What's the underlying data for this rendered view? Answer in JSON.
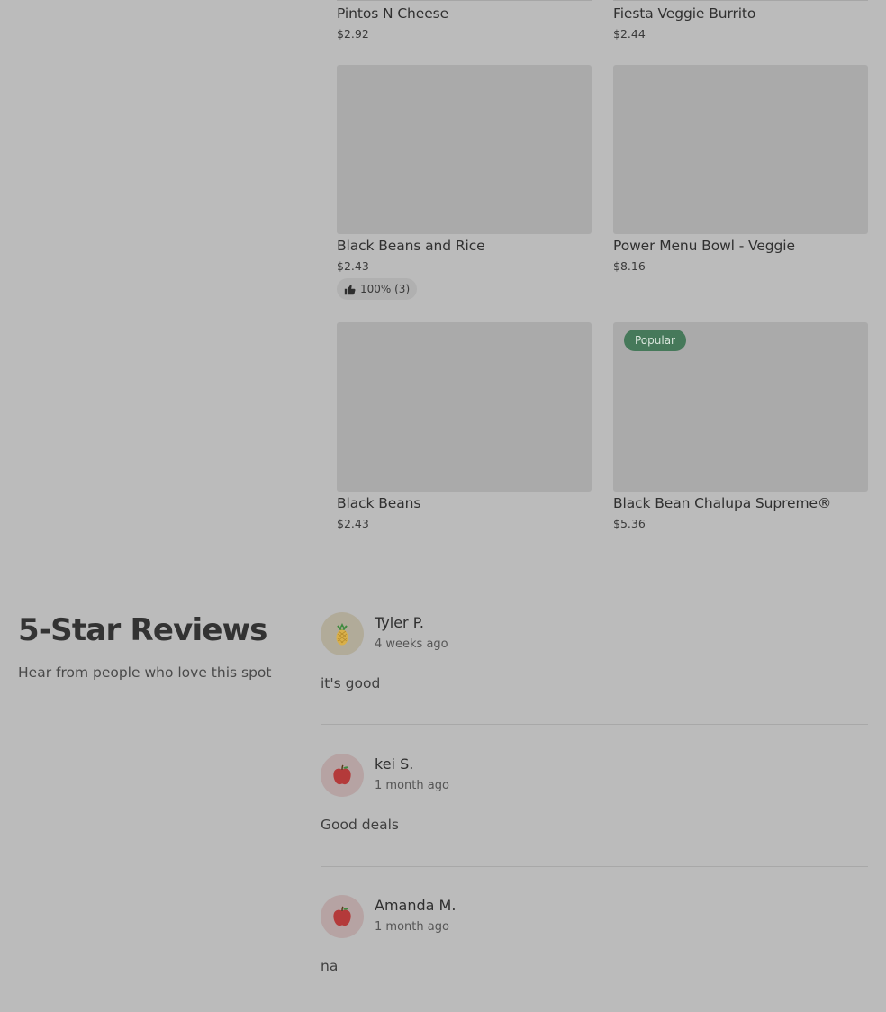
{
  "menu_items": [
    {
      "name": "Pintos N Cheese",
      "price": "$2.92"
    },
    {
      "name": "Fiesta Veggie Burrito",
      "price": "$2.44"
    },
    {
      "name": "Black Beans and Rice",
      "price": "$2.43",
      "rating": "100% (3)"
    },
    {
      "name": "Power Menu Bowl - Veggie",
      "price": "$8.16"
    },
    {
      "name": "Black Beans",
      "price": "$2.43"
    },
    {
      "name": "Black Bean Chalupa Supreme®",
      "price": "$5.36",
      "badge": "Popular"
    }
  ],
  "reviews_section": {
    "title": "5-Star Reviews",
    "subtitle": "Hear from people who love this spot",
    "reviews": [
      {
        "name": "Tyler P.",
        "time": "4 weeks ago",
        "text": "it's good",
        "avatar_icon": "pineapple-icon"
      },
      {
        "name": "kei S.",
        "time": "1 month ago",
        "text": "Good deals",
        "avatar_icon": "apple-icon"
      },
      {
        "name": "Amanda M.",
        "time": "1 month ago",
        "text": "na",
        "avatar_icon": "apple-icon"
      }
    ]
  },
  "colors": {
    "background": "#bbbbbb",
    "image_placeholder": "#aaaaaa",
    "popular_badge": "#46795a"
  }
}
